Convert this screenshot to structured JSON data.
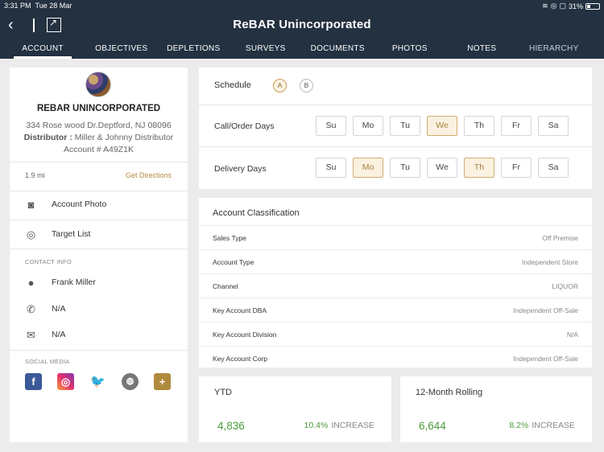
{
  "status": {
    "time": "3:31 PM",
    "date": "Tue 28 Mar",
    "battery": "31%"
  },
  "header": {
    "title": "ReBAR Unincorporated"
  },
  "tabs": [
    "ACCOUNT",
    "OBJECTIVES",
    "DEPLETIONS",
    "SURVEYS",
    "DOCUMENTS",
    "PHOTOS",
    "NOTES",
    "HIERARCHY"
  ],
  "account": {
    "name": "REBAR UNINCORPORATED",
    "address": "334 Rose wood Dr.Deptford, NJ 08096",
    "distributor_label": "Distributor :",
    "distributor": "Miller & Johnny Distributor",
    "account_number": "Account # A49Z1K",
    "distance": "1.9 mi",
    "directions": "Get Directions",
    "photo_label": "Account Photo",
    "target_label": "Target List"
  },
  "contact": {
    "heading": "CONTACT INFO",
    "name": "Frank Miller",
    "phone": "N/A",
    "email": "N/A"
  },
  "social": {
    "heading": "SOCIAL MEDIA",
    "fb": "f",
    "ig": "◎",
    "tw": "🐦",
    "web": "◍",
    "add": "+"
  },
  "schedule": {
    "label": "Schedule",
    "options": [
      "A",
      "B"
    ],
    "selected": "A",
    "call_label": "Call/Order Days",
    "delivery_label": "Delivery Days",
    "days": [
      "Su",
      "Mo",
      "Tu",
      "We",
      "Th",
      "Fr",
      "Sa"
    ],
    "call_selected": [
      "We"
    ],
    "delivery_selected": [
      "Mo",
      "Th"
    ]
  },
  "classification": {
    "title": "Account Classification",
    "rows": [
      {
        "k": "Sales Type",
        "v": "Off Premise"
      },
      {
        "k": "Account Type",
        "v": "Independent Store"
      },
      {
        "k": "Channel",
        "v": "LIQUOR"
      },
      {
        "k": "Key Account DBA",
        "v": "Independent Off-Sale"
      },
      {
        "k": "Key Account Division",
        "v": "N/A"
      },
      {
        "k": "Key Account Corp",
        "v": "Independent Off-Sale"
      }
    ]
  },
  "stats": {
    "ytd": {
      "title": "YTD",
      "value": "4,836",
      "pct": "10.4%",
      "trend": "INCREASE"
    },
    "rolling": {
      "title": "12-Month Rolling",
      "value": "6,644",
      "pct": "8.2%",
      "trend": "INCREASE"
    }
  },
  "colors": {
    "header": "#233141",
    "accent": "#b08a3e",
    "positive": "#4a9a3a"
  }
}
